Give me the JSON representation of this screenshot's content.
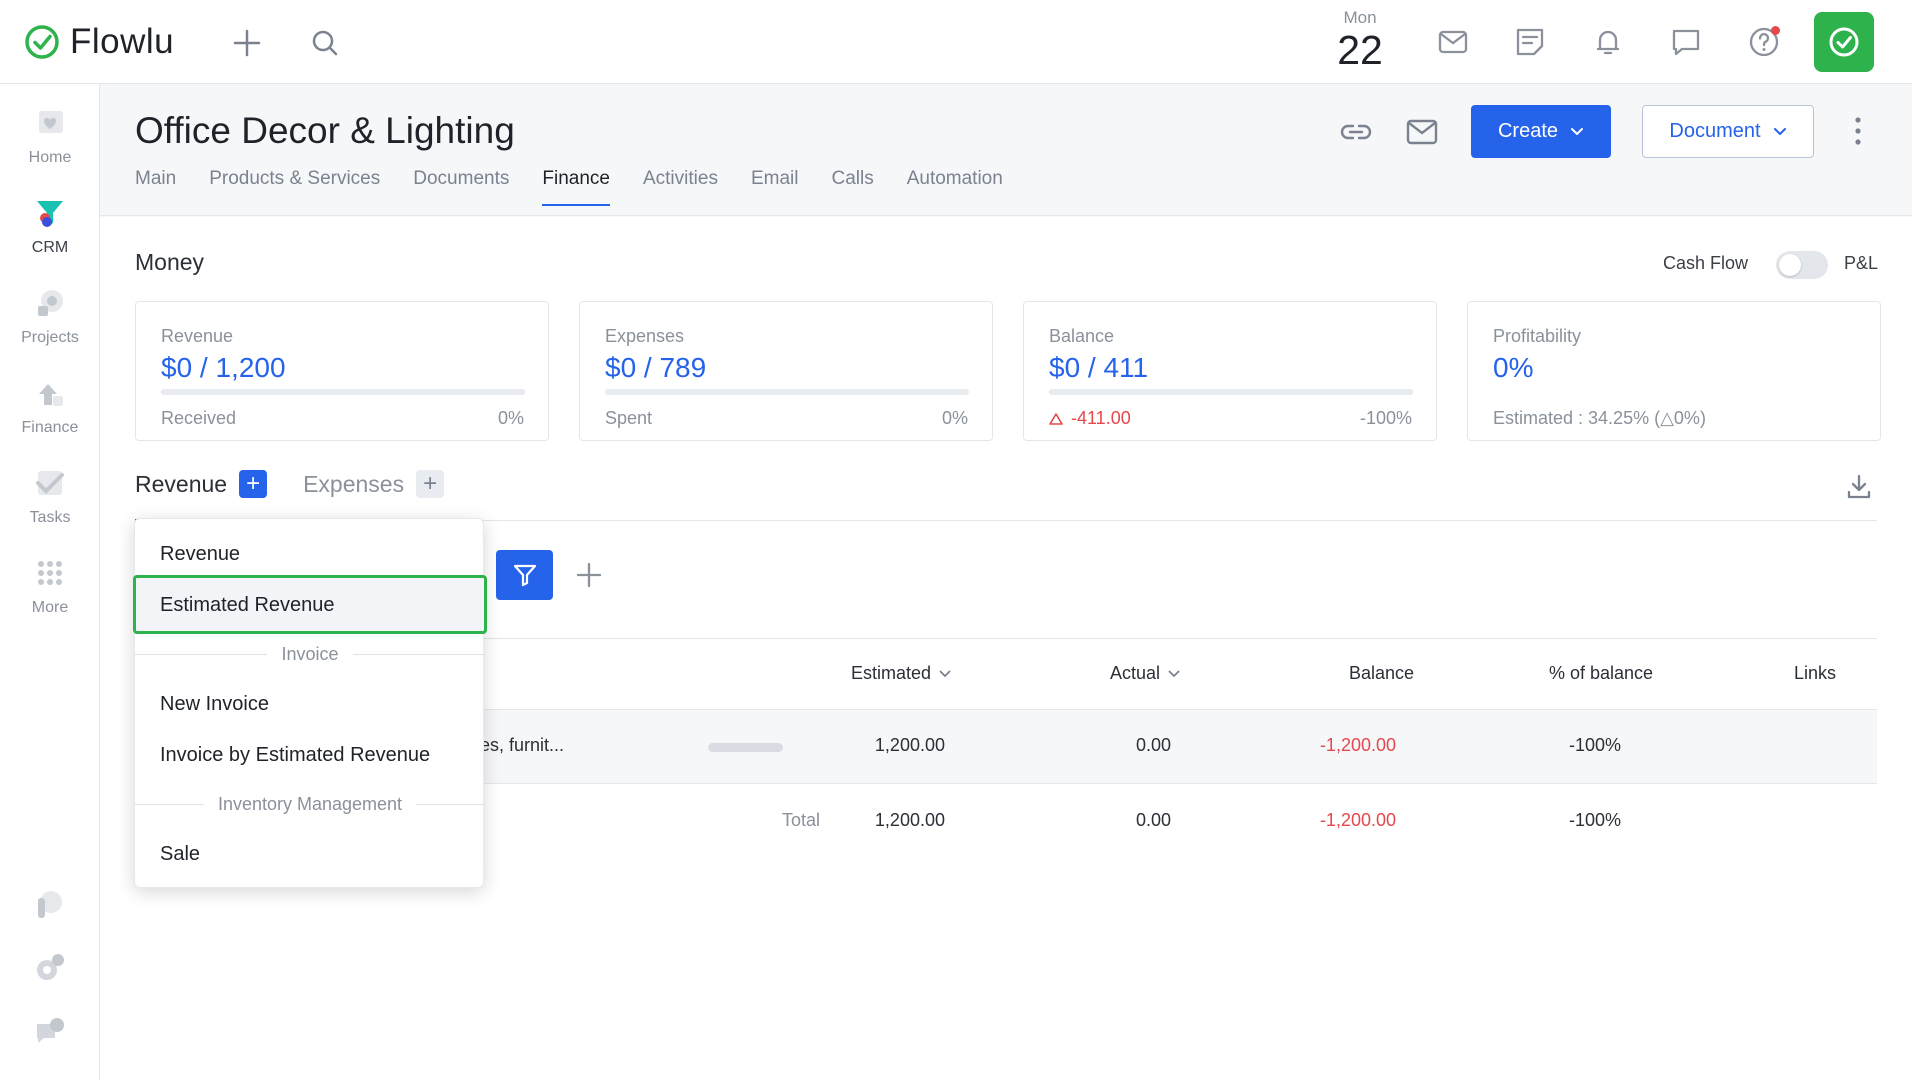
{
  "app": {
    "name": "Flowlu"
  },
  "date": {
    "dow": "Mon",
    "day": "22"
  },
  "sidebar": {
    "items": [
      {
        "label": "Home"
      },
      {
        "label": "CRM"
      },
      {
        "label": "Projects"
      },
      {
        "label": "Finance"
      },
      {
        "label": "Tasks"
      },
      {
        "label": "More"
      }
    ]
  },
  "page": {
    "title": "Office Decor & Lighting",
    "tabs": [
      "Main",
      "Products & Services",
      "Documents",
      "Finance",
      "Activities",
      "Email",
      "Calls",
      "Automation"
    ],
    "active_tab": "Finance",
    "create_label": "Create",
    "document_label": "Document"
  },
  "money": {
    "title": "Money",
    "cash_flow": "Cash Flow",
    "pl": "P&L",
    "cards": [
      {
        "label": "Revenue",
        "value": "$0 / 1,200",
        "sub": "Received",
        "pct": "0%",
        "progress": 0
      },
      {
        "label": "Expenses",
        "value": "$0 / 789",
        "sub": "Spent",
        "pct": "0%",
        "progress": 0
      },
      {
        "label": "Balance",
        "value": "$0 / 411",
        "sub": "-411.00",
        "pct": "-100%",
        "progress": 0
      },
      {
        "label": "Profitability",
        "value": "0%",
        "est": "Estimated : 34.25% (△0%)"
      }
    ]
  },
  "subtabs": {
    "revenue": "Revenue",
    "expenses": "Expenses"
  },
  "table": {
    "headers": {
      "estimated": "Estimated",
      "actual": "Actual",
      "balance": "Balance",
      "pct": "% of balance",
      "links": "Links"
    },
    "row": {
      "name": "t fixtures, furnit...",
      "estimated": "1,200.00",
      "actual": "0.00",
      "balance": "-1,200.00",
      "pct": "-100%"
    },
    "total": {
      "label": "Total",
      "estimated": "1,200.00",
      "actual": "0.00",
      "balance": "-1,200.00",
      "pct": "-100%"
    }
  },
  "dropdown": {
    "item1": "Revenue",
    "item2": "Estimated Revenue",
    "sep1": "Invoice",
    "item3": "New Invoice",
    "item4": "Invoice by Estimated Revenue",
    "sep2": "Inventory Management",
    "item5": "Sale"
  },
  "colors": {
    "accent": "#2563eb",
    "brand_green": "#2eb24c",
    "negative": "#e5484d"
  }
}
